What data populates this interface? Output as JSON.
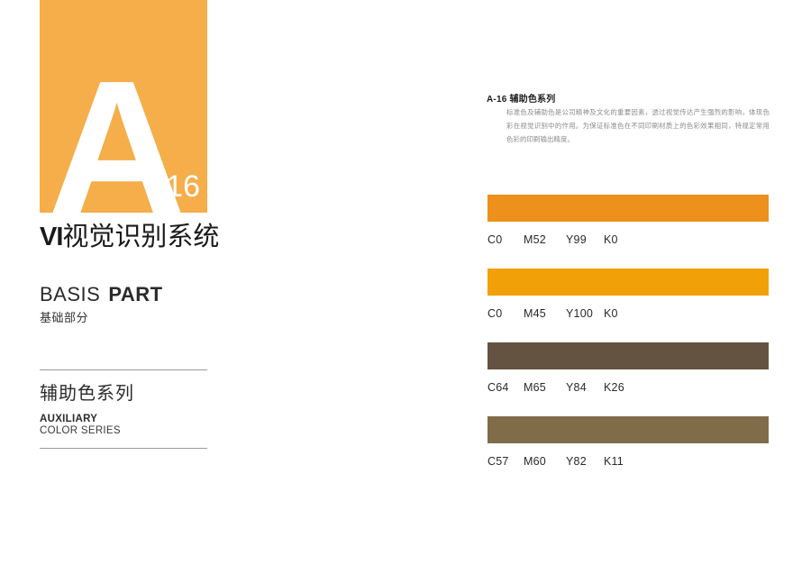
{
  "cover": {
    "letter": "A",
    "number": "-16",
    "block_color": "#f5ae4a",
    "title_mark": "VI",
    "title_cn": "视觉识别系统"
  },
  "basis": {
    "en_light": "BASIS",
    "en_bold": "PART",
    "cn": "基础部分"
  },
  "section": {
    "cn": "辅助色系列",
    "en_bold": "AUXILIARY",
    "en_sub": "COLOR SERIES"
  },
  "content": {
    "heading": "A-16 辅助色系列",
    "paragraph": "标准色及辅助色是公司精神及文化的重要因素，透过视觉传达产生强烈的影响，体现色彩在视觉识别中的作用。为保证标准色在不同印刷材质上的色彩效果相同，特规定常用色彩的印刷输出精度。"
  },
  "swatches": [
    {
      "hex": "#ed901c",
      "c": "C0",
      "m": "M52",
      "y": "Y99",
      "k": "K0"
    },
    {
      "hex": "#f2a007",
      "c": "C0",
      "m": "M45",
      "y": "Y100",
      "k": "K0"
    },
    {
      "hex": "#645340",
      "c": "C64",
      "m": "M65",
      "y": "Y84",
      "k": "K26"
    },
    {
      "hex": "#816c49",
      "c": "C57",
      "m": "M60",
      "y": "Y82",
      "k": "K11"
    }
  ]
}
